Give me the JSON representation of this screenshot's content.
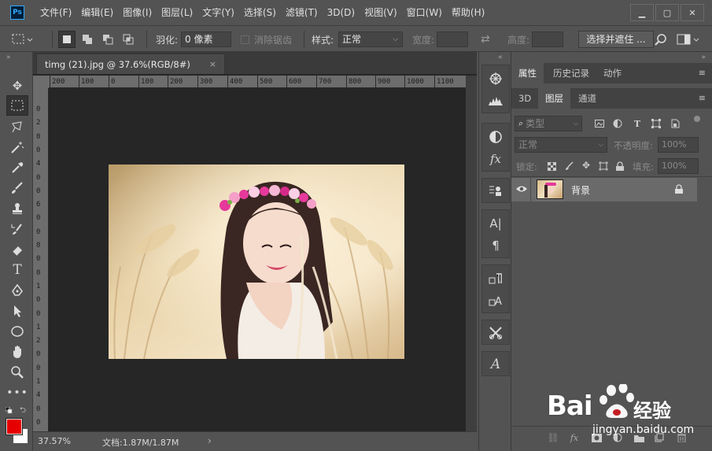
{
  "app": {
    "logo": "Ps"
  },
  "menu": [
    "文件(F)",
    "编辑(E)",
    "图像(I)",
    "图层(L)",
    "文字(Y)",
    "选择(S)",
    "滤镜(T)",
    "3D(D)",
    "视图(V)",
    "窗口(W)",
    "帮助(H)"
  ],
  "window_controls": {
    "minimize": "▁",
    "restore": "▢",
    "close": "✕"
  },
  "options": {
    "feather_label": "羽化:",
    "feather_value": "0 像素",
    "antialias_label": "消除锯齿",
    "style_label": "样式:",
    "style_value": "正常",
    "width_label": "宽度:",
    "height_label": "高度:",
    "select_mask_label": "选择并遮住 ..."
  },
  "document": {
    "tab_title": "timg (21).jpg @ 37.6%(RGB/8#)",
    "tab_close": "×",
    "zoom": "37.57%",
    "doc_info": "文档:1.87M/1.87M",
    "status_arrow": "›"
  },
  "ruler": {
    "top": [
      "200",
      "100",
      "0",
      "100",
      "200",
      "300",
      "400",
      "500",
      "600",
      "700",
      "800",
      "900",
      "1000",
      "1100"
    ],
    "left": [
      "0",
      "2",
      "0",
      "0",
      "4",
      "0",
      "0",
      "6",
      "0",
      "0",
      "8",
      "0",
      "0",
      "1",
      "0",
      "0",
      "1",
      "2",
      "0",
      "0",
      "1",
      "4",
      "0",
      "0"
    ]
  },
  "panels": {
    "top_tabs": [
      "属性",
      "历史记录",
      "动作"
    ],
    "sub_tabs": [
      "3D",
      "图层",
      "通道"
    ],
    "filter_label": "类型",
    "blend_mode": "正常",
    "opacity_label": "不透明度:",
    "opacity_value": "100%",
    "lock_label": "锁定:",
    "fill_label": "填充:",
    "fill_value": "100%",
    "layer_name": "背景"
  },
  "watermark": {
    "brand": "Bai",
    "brand2": "经验",
    "url": "jingyan.baidu.com"
  },
  "colors": {
    "foreground": "#e60000",
    "background": "#ffffff",
    "accent": "#31a8ff"
  }
}
